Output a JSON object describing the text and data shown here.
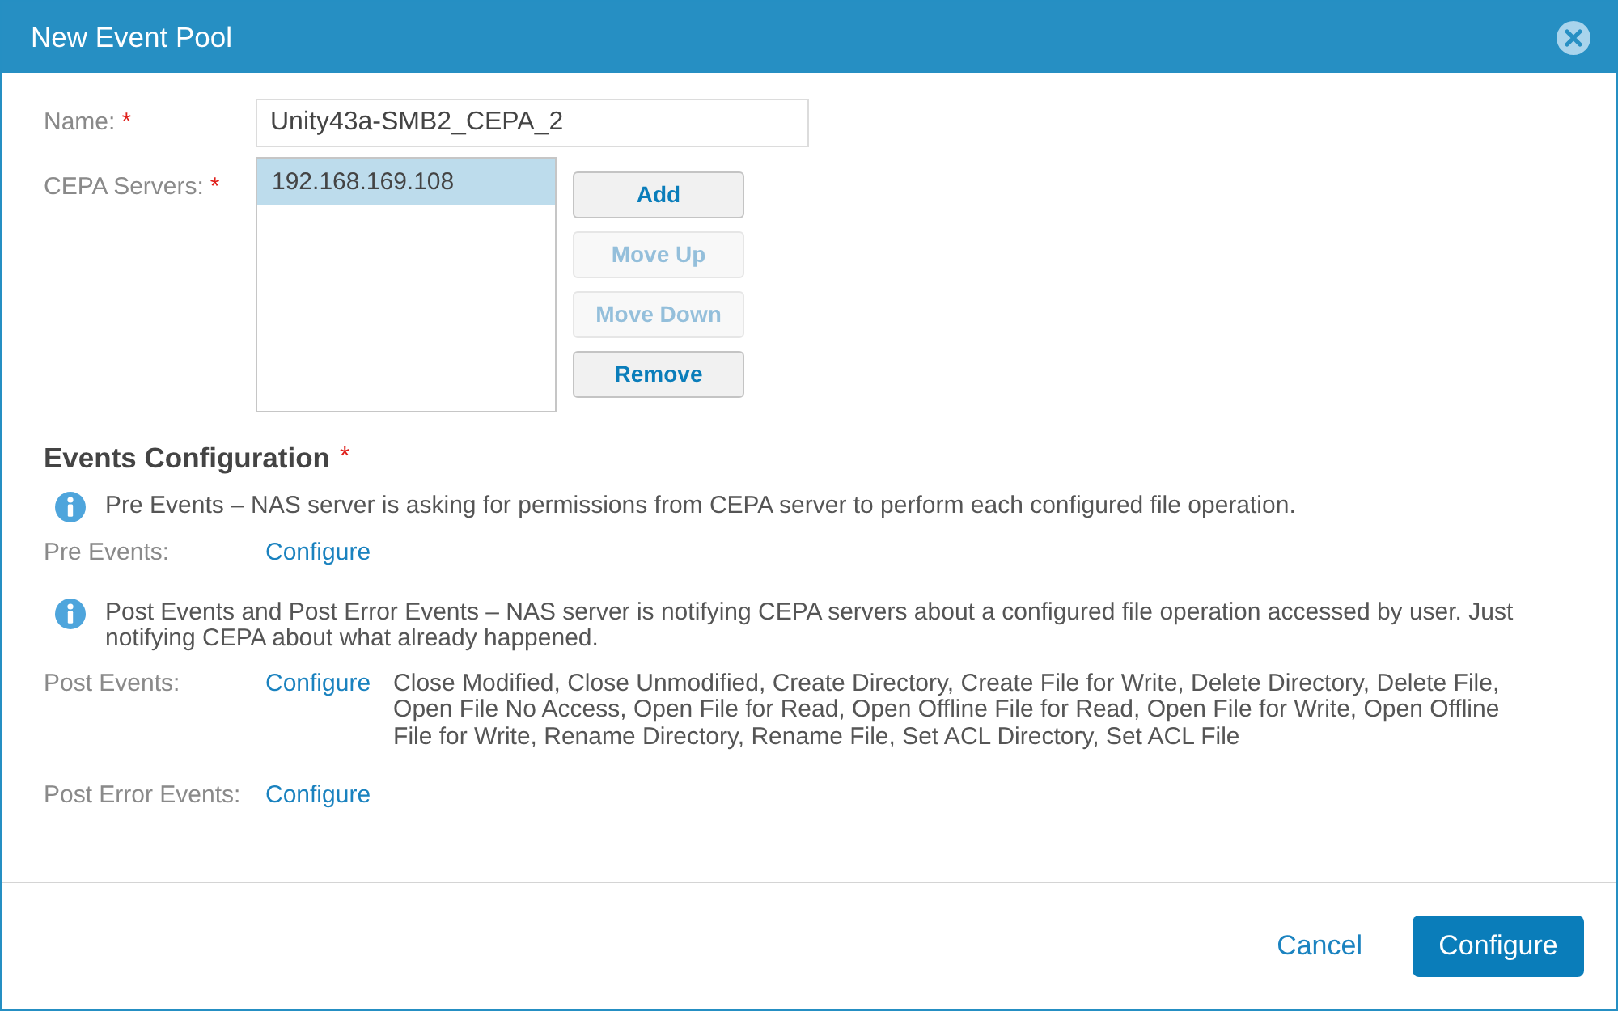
{
  "dialog": {
    "title": "New Event Pool"
  },
  "name_field": {
    "label": "Name:",
    "required_mark": "*",
    "value": "Unity43a-SMB2_CEPA_2"
  },
  "cepa_servers": {
    "label": "CEPA Servers:",
    "required_mark": "*",
    "items": [
      {
        "text": "192.168.169.108",
        "selected": true
      }
    ],
    "buttons": [
      {
        "label": "Add",
        "disabled": false
      },
      {
        "label": "Move Up",
        "disabled": true
      },
      {
        "label": "Move Down",
        "disabled": true
      },
      {
        "label": "Remove",
        "disabled": false
      }
    ]
  },
  "events_configuration": {
    "heading": "Events Configuration",
    "required_mark": "*",
    "rows": [
      {
        "kind": "info",
        "text": "Pre Events – NAS server is asking for permissions from CEPA server to perform each configured file operation."
      },
      {
        "kind": "setting",
        "label": "Pre Events:",
        "link": "Configure"
      },
      {
        "kind": "info",
        "text": "Post Events and Post Error Events – NAS server is notifying CEPA servers about a configured file operation accessed by user. Just notifying CEPA about what already happened."
      },
      {
        "kind": "setting",
        "label": "Post Events:",
        "link": "Configure",
        "value": "Close Modified, Close Unmodified, Create Directory, Create File for Write, Delete Directory, Delete File, Open File No Access, Open File for Read, Open Offline File for Read, Open File for Write, Open Offline File for Write, Rename Directory, Rename File, Set ACL Directory, Set ACL File"
      },
      {
        "kind": "setting",
        "label": "Post Error Events:",
        "link": "Configure"
      }
    ]
  },
  "footer": {
    "buttons": [
      {
        "label": "Cancel",
        "kind": "link"
      },
      {
        "label": "Configure",
        "kind": "primary"
      }
    ]
  }
}
